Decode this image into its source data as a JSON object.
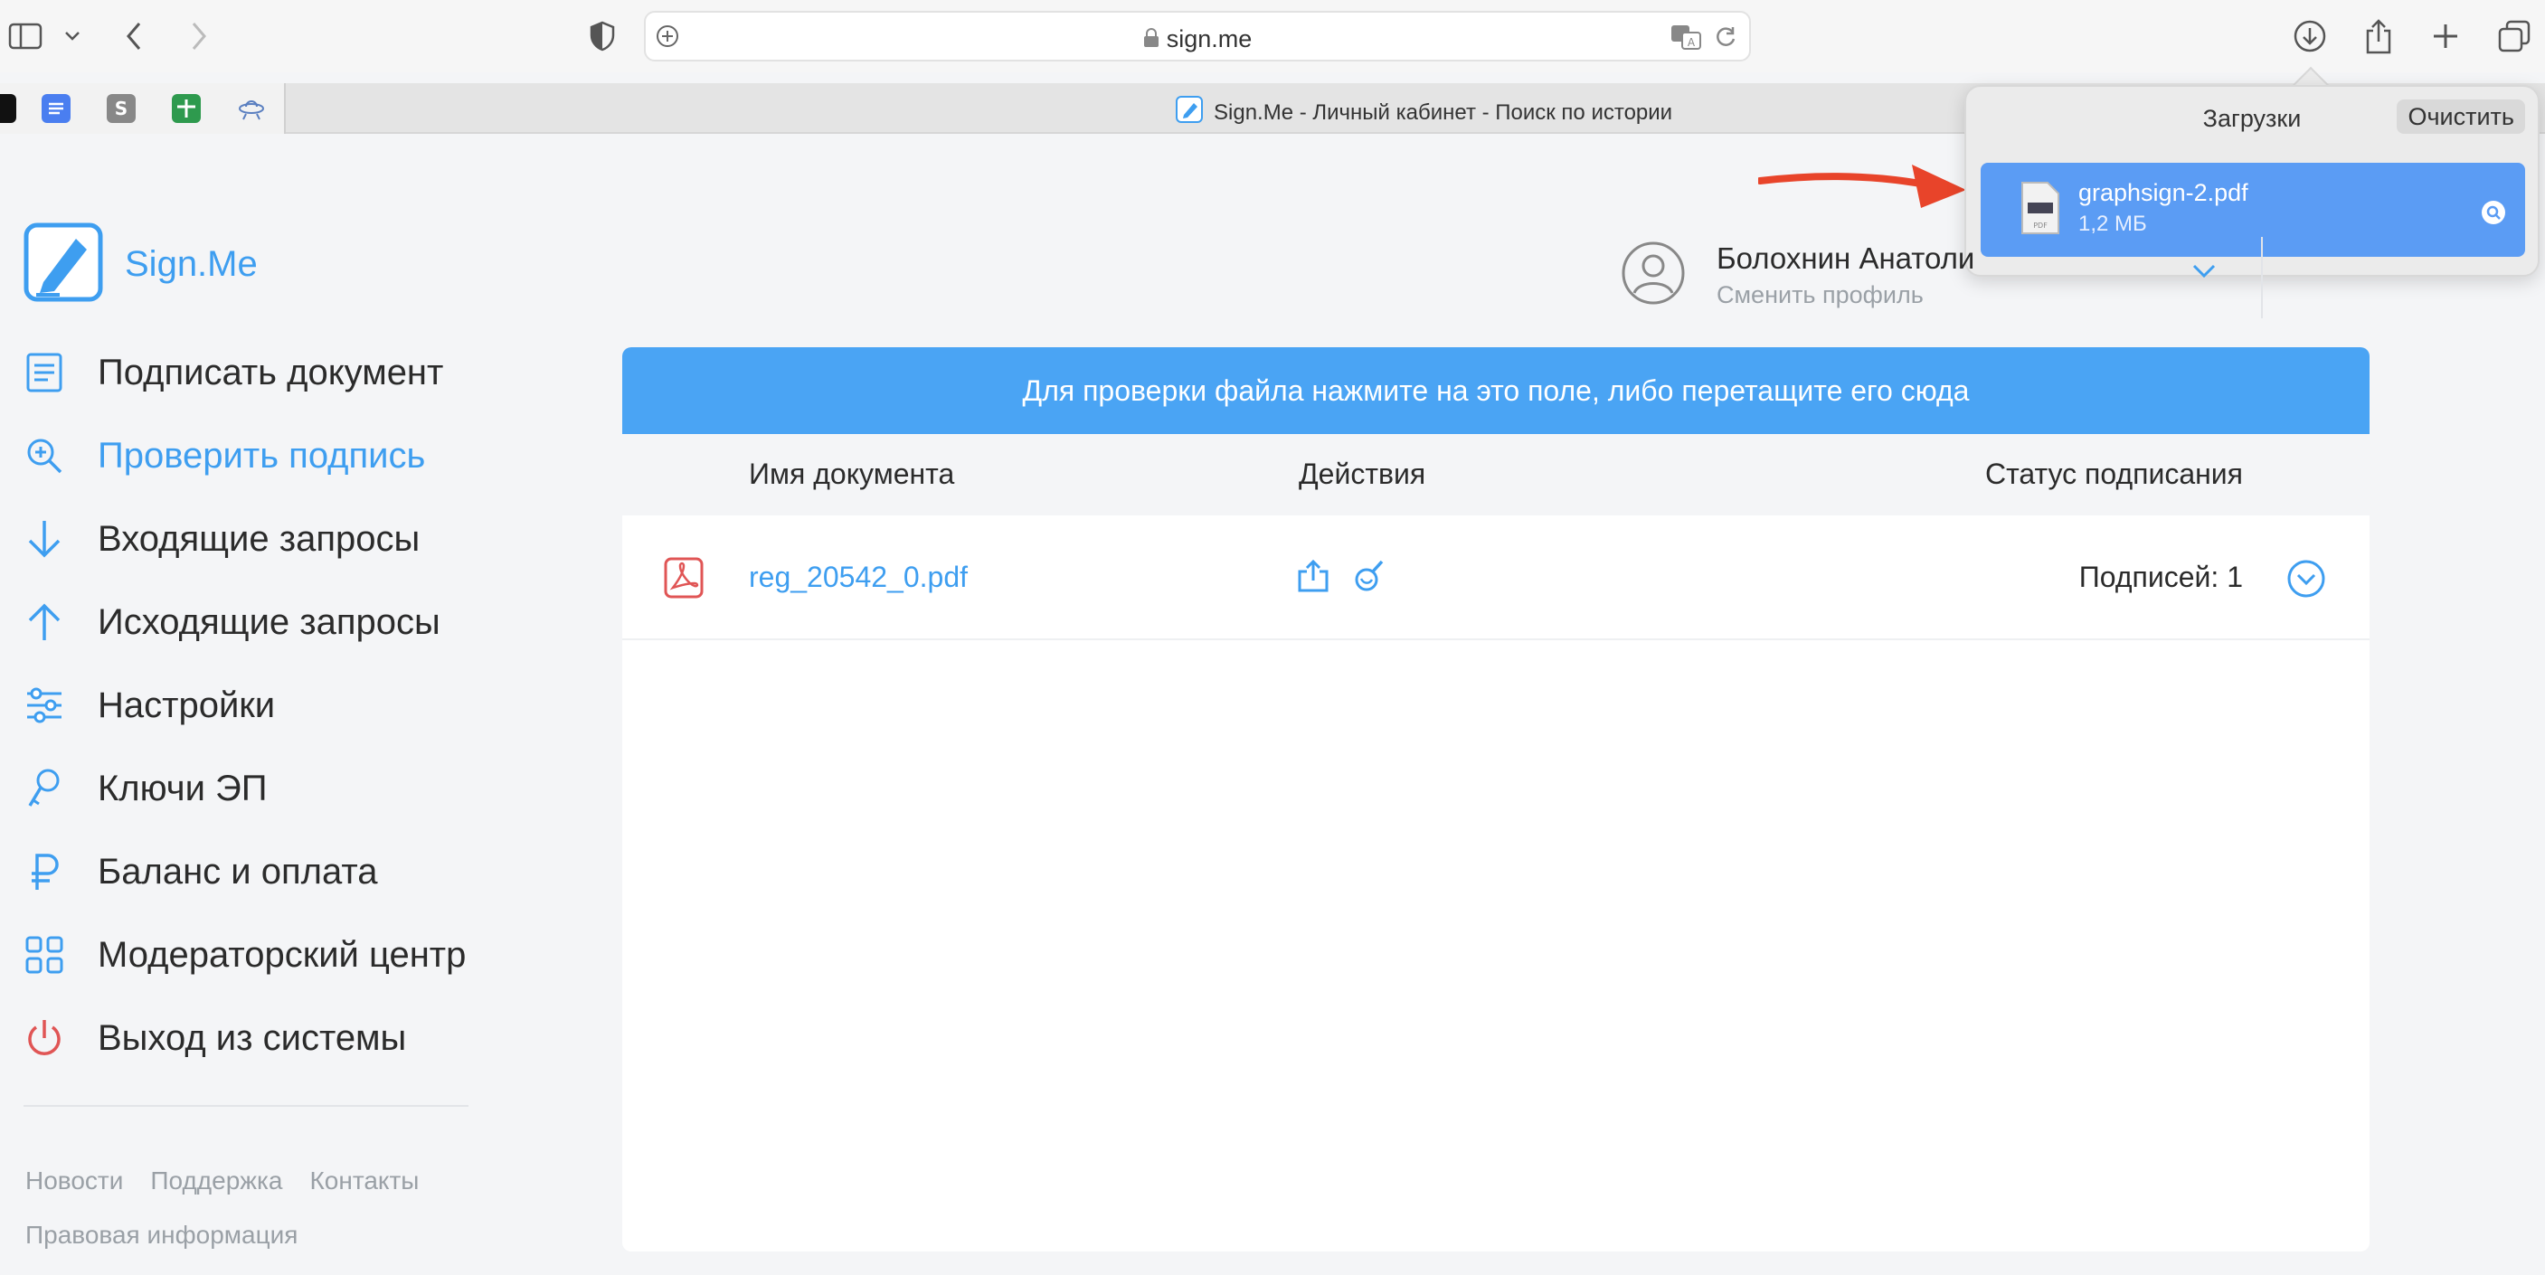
{
  "browser": {
    "url": "sign.me",
    "tab_title": "Sign.Me - Личный кабинет - Поиск по истории"
  },
  "downloads": {
    "title": "Загрузки",
    "clear_label": "Очистить",
    "items": [
      {
        "name": "graphsign-2.pdf",
        "size": "1,2 МБ"
      }
    ]
  },
  "logo": {
    "text": "Sign.Me"
  },
  "nav": [
    {
      "label": "Подписать документ",
      "icon": "document-icon",
      "active": false
    },
    {
      "label": "Проверить подпись",
      "icon": "search-icon",
      "active": true
    },
    {
      "label": "Входящие запросы",
      "icon": "arrow-down-icon",
      "active": false
    },
    {
      "label": "Исходящие запросы",
      "icon": "arrow-up-icon",
      "active": false
    },
    {
      "label": "Настройки",
      "icon": "sliders-icon",
      "active": false
    },
    {
      "label": "Ключи ЭП",
      "icon": "key-icon",
      "active": false
    },
    {
      "label": "Баланс и оплата",
      "icon": "ruble-icon",
      "active": false
    },
    {
      "label": "Модераторский центр",
      "icon": "grid-icon",
      "active": false
    },
    {
      "label": "Выход из системы",
      "icon": "power-icon",
      "active": false
    }
  ],
  "footer": {
    "news": "Новости",
    "support": "Поддержка",
    "contacts": "Контакты",
    "legal": "Правовая информация"
  },
  "profile": {
    "name": "Болохнин Анатоли",
    "action": "Сменить профиль"
  },
  "main": {
    "dropzone_text": "Для проверки файла нажмите на это поле, либо перетащите его сюда",
    "columns": {
      "name": "Имя документа",
      "actions": "Действия",
      "status": "Статус подписания"
    },
    "rows": [
      {
        "file": "reg_20542_0.pdf",
        "status": "Подписей: 1"
      }
    ]
  },
  "colors": {
    "accent": "#3e9ef0",
    "dropzone": "#4aa4f4",
    "download_selected": "#5b9cf4",
    "danger": "#e05555",
    "annotation_arrow": "#e8442a"
  }
}
